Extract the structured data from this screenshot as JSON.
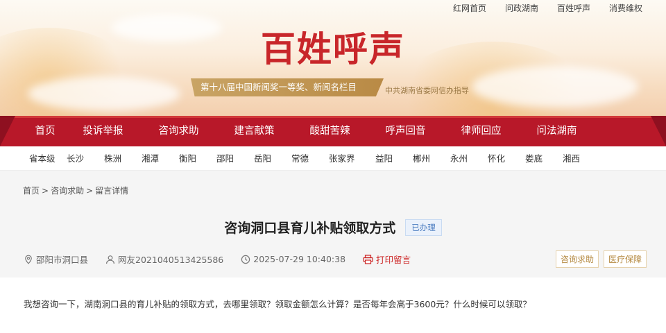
{
  "top_links": [
    "红网首页",
    "问政湖南",
    "百姓呼声",
    "消费维权"
  ],
  "logo_text": "百姓呼声",
  "award": "第十八届中国新闻奖一等奖、新闻名栏目",
  "guide": "中共湖南省委网信办指导",
  "nav": [
    "首页",
    "投诉举报",
    "咨询求助",
    "建言献策",
    "酸甜苦辣",
    "呼声回音",
    "律师回应",
    "问法湖南"
  ],
  "regions": [
    "省本级",
    "长沙",
    "株洲",
    "湘潭",
    "衡阳",
    "邵阳",
    "岳阳",
    "常德",
    "张家界",
    "益阳",
    "郴州",
    "永州",
    "怀化",
    "娄底",
    "湘西"
  ],
  "breadcrumb": {
    "home": "首页",
    "section": "咨询求助",
    "current": "留言详情",
    "sep": ">"
  },
  "post": {
    "title": "咨询洞口县育儿补贴领取方式",
    "status": "已办理",
    "location": "邵阳市洞口县",
    "user": "网友2021040513425586",
    "time": "2025-07-29 10:40:38",
    "print": "打印留言",
    "tags": [
      "咨询求助",
      "医疗保障"
    ],
    "body": "我想咨询一下，湖南洞口县的育儿补贴的领取方式，去哪里领取？领取金额怎么计算？是否每年会高于3600元？什么时候可以领取？"
  },
  "colors": {
    "nav_red": "#b81829",
    "gold": "#b98a45",
    "status_blue": "#4a7cc0"
  }
}
